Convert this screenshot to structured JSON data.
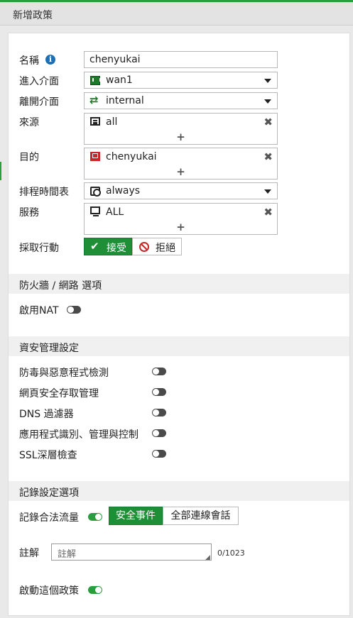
{
  "dialog": {
    "title": "新增政策"
  },
  "form": {
    "name": {
      "label": "名稱",
      "value": "chenyukai"
    },
    "incoming": {
      "label": "進入介面",
      "value": "wan1",
      "icon": "interface-icon"
    },
    "outgoing": {
      "label": "離開介面",
      "value": "internal",
      "icon": "shuffle-arrows-icon"
    },
    "source": {
      "label": "來源",
      "value": "all",
      "icon": "address-icon"
    },
    "destination": {
      "label": "目的",
      "value": "chenyukai",
      "icon": "user-address-icon"
    },
    "schedule": {
      "label": "排程時間表",
      "value": "always",
      "icon": "schedule-icon"
    },
    "service": {
      "label": "服務",
      "value": "ALL",
      "icon": "service-icon"
    },
    "action": {
      "label": "採取行動",
      "accept": "接受",
      "deny": "拒絕",
      "selected": "accept"
    }
  },
  "firewall": {
    "header": "防火牆 / 網路 選項",
    "nat": {
      "label": "啟用NAT",
      "enabled": false
    }
  },
  "security": {
    "header": "資安管理設定",
    "items": [
      {
        "label": "防毒與惡意程式檢測",
        "enabled": false
      },
      {
        "label": "網頁安全存取管理",
        "enabled": false
      },
      {
        "label": "DNS 過濾器",
        "enabled": false
      },
      {
        "label": "應用程式識別、管理與控制",
        "enabled": false
      },
      {
        "label": "SSL深層檢查",
        "enabled": false
      }
    ]
  },
  "logging": {
    "header": "記錄設定選項",
    "log_traffic": {
      "label": "記錄合法流量",
      "enabled": true
    },
    "mode_security": "安全事件",
    "mode_all": "全部連線會話",
    "selected_mode": "安全事件",
    "comment": {
      "label": "註解",
      "placeholder": "註解",
      "counter": "0/1023"
    },
    "enable_policy": {
      "label": "啟動這個政策",
      "enabled": true
    }
  },
  "colors": {
    "accent": "#2a9d3e",
    "button_green": "#1e8f36",
    "deny_red": "#c62828"
  }
}
